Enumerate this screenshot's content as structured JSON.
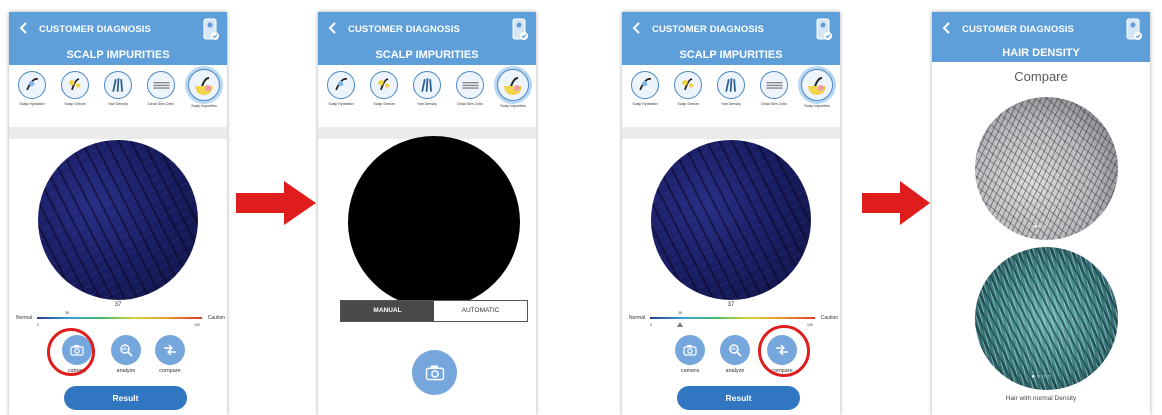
{
  "colors": {
    "header": "#5e9fd9",
    "accent": "#3176c1",
    "highlight": "#e01d1d",
    "arrow": "#e01d1d"
  },
  "screens": [
    {
      "header_title": "CUSTOMER DIAGNOSIS",
      "sub_title": "SCALP IMPURITIES",
      "categories": [
        "Scalp Hydration",
        "Scalp Sebum",
        "Hair Density",
        "Dead Skin Cells",
        "Scalp Impurities"
      ],
      "reading": "37",
      "scale": {
        "low_label": "Normal",
        "high_label": "Caution",
        "marker": "35",
        "min": "0",
        "max": "100"
      },
      "actions": [
        "camera",
        "analyze",
        "compare"
      ],
      "result_button": "Result"
    },
    {
      "header_title": "CUSTOMER DIAGNOSIS",
      "sub_title": "SCALP IMPURITIES",
      "categories": [
        "Scalp Hydration",
        "Scalp Sebum",
        "Hair Density",
        "Dead Skin Cells",
        "Scalp Impurities"
      ],
      "mode_toggle": [
        "MANUAL",
        "AUTOMATIC"
      ]
    },
    {
      "header_title": "CUSTOMER DIAGNOSIS",
      "sub_title": "SCALP IMPURITIES",
      "categories": [
        "Scalp Hydration",
        "Scalp Sebum",
        "Hair Density",
        "Dead Skin Cells",
        "Scalp Impurities"
      ],
      "reading": "37",
      "scale": {
        "low_label": "Normal",
        "high_label": "Caution",
        "marker": "35",
        "min": "0",
        "max": "100"
      },
      "actions": [
        "camera",
        "analyze",
        "compare"
      ],
      "result_button": "Result"
    },
    {
      "header_title": "CUSTOMER DIAGNOSIS",
      "sub_title": "HAIR DENSITY",
      "compare_title": "Compare",
      "caption": "Hair with normal Density"
    }
  ]
}
